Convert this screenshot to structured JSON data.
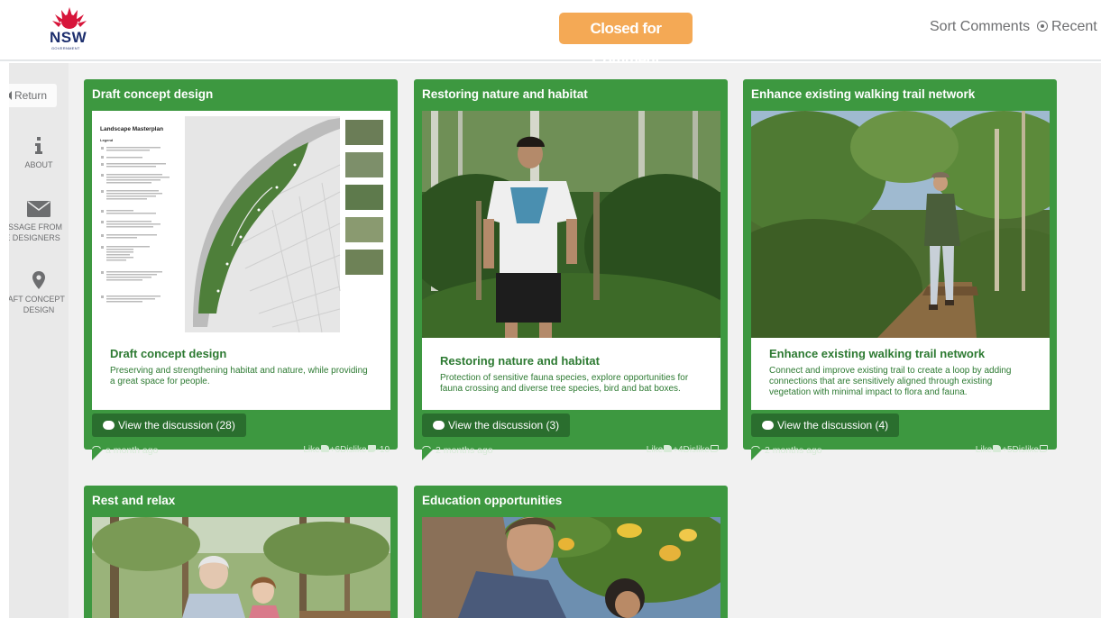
{
  "header": {
    "logo_text": "NSW",
    "logo_subtext": "GOVERNMENT",
    "status": "Closed for Comment",
    "sort_label": "Sort Comments",
    "sort_option": "Recent"
  },
  "sidebar": {
    "return_label": "Return",
    "items": [
      {
        "label_line1": "ABOUT",
        "label_line2": ""
      },
      {
        "label_line1": "ESSAGE FROM",
        "label_line2": "E DESIGNERS"
      },
      {
        "label_line1": "RAFT CONCEPT",
        "label_line2": "DESIGN"
      }
    ]
  },
  "cards": [
    {
      "title": "Draft concept design",
      "caption_title": "Draft concept design",
      "caption_text": "Preserving and strengthening habitat and nature, while providing a great space for people.",
      "map_heading": "Landscape Masterplan",
      "map_legend_label": "Legend",
      "discussion": "View the discussion (28)",
      "time": "a month ago",
      "votes": {
        "like_label": "Like",
        "like_count": "+6",
        "dislike_label": "Dislike",
        "dislike_count": "-10"
      }
    },
    {
      "title": "Restoring nature and habitat",
      "caption_title": "Restoring nature and habitat",
      "caption_text": "Protection of sensitive fauna species, explore opportunities for fauna crossing and diverse tree species, bird and bat boxes.",
      "discussion": "View the discussion (3)",
      "time": "2 months ago",
      "votes": {
        "like_label": "Like",
        "like_count": "+4",
        "dislike_label": "Dislike",
        "dislike_count": ""
      }
    },
    {
      "title": "Enhance existing walking trail network",
      "caption_title": "Enhance existing walking trail network",
      "caption_text": "Connect and improve existing trail to create a loop by adding connections that are sensitively aligned through existing vegetation with minimal impact to flora and fauna.",
      "discussion": "View the discussion (4)",
      "time": "2 months ago",
      "votes": {
        "like_label": "Like",
        "like_count": "+5",
        "dislike_label": "Dislike",
        "dislike_count": ""
      }
    },
    {
      "title": "Rest and relax"
    },
    {
      "title": "Education opportunities"
    }
  ],
  "colors": {
    "card_green": "#3d9840",
    "button_green": "#2a6e2e",
    "badge_orange": "#f4a955",
    "text_green": "#2d7a32"
  },
  "icons": {
    "about": "info-icon",
    "message": "envelope-icon",
    "design": "map-pin-icon"
  }
}
